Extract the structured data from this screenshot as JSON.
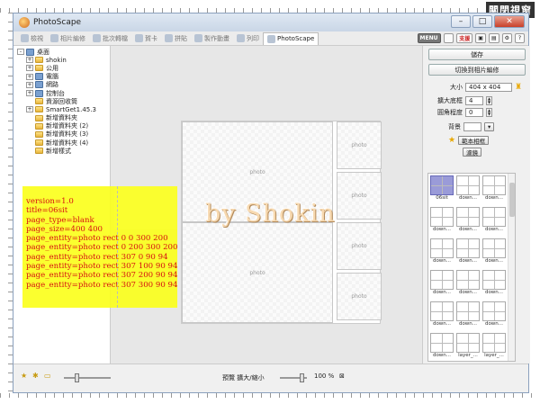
{
  "corner_label": "關閉視窗",
  "window": {
    "title": "PhotoScape"
  },
  "tabs": [
    {
      "label": "檢視",
      "active": false
    },
    {
      "label": "相片編修",
      "active": false
    },
    {
      "label": "批次轉檔",
      "active": false
    },
    {
      "label": "賀卡",
      "active": false
    },
    {
      "label": "拼貼",
      "active": false
    },
    {
      "label": "製作動畫",
      "active": false
    },
    {
      "label": "列印",
      "active": false
    },
    {
      "label": "PhotoScape",
      "active": true
    }
  ],
  "toolbar": {
    "menu_label": "MENU",
    "support_label": "支援"
  },
  "tree": [
    {
      "label": "桌面",
      "level": 0,
      "expander": "-",
      "icon": "desktop"
    },
    {
      "label": "shokin",
      "level": 1,
      "expander": "+",
      "icon": "folder"
    },
    {
      "label": "公用",
      "level": 1,
      "expander": "+",
      "icon": "folder"
    },
    {
      "label": "電腦",
      "level": 1,
      "expander": "+",
      "icon": "computer"
    },
    {
      "label": "網路",
      "level": 1,
      "expander": "+",
      "icon": "network"
    },
    {
      "label": "控制台",
      "level": 1,
      "expander": "+",
      "icon": "control"
    },
    {
      "label": "資源回收筒",
      "level": 1,
      "expander": "",
      "icon": "recycle"
    },
    {
      "label": "SmartGet1.45.3",
      "level": 1,
      "expander": "+",
      "icon": "folder"
    },
    {
      "label": "新增資料夾",
      "level": 1,
      "expander": "",
      "icon": "folder"
    },
    {
      "label": "新增資料夾 (2)",
      "level": 1,
      "expander": "",
      "icon": "folder"
    },
    {
      "label": "新增資料夾 (3)",
      "level": 1,
      "expander": "",
      "icon": "folder"
    },
    {
      "label": "新增資料夾 (4)",
      "level": 1,
      "expander": "",
      "icon": "folder"
    },
    {
      "label": "新增樣式",
      "level": 1,
      "expander": "",
      "icon": "folder"
    }
  ],
  "canvas": {
    "slot_label": "photo",
    "slots": [
      {
        "label": "photo"
      },
      {
        "label": "photo"
      },
      {
        "label": "photo"
      },
      {
        "label": "photo"
      },
      {
        "label": "photo"
      },
      {
        "label": "photo"
      }
    ]
  },
  "right_panel": {
    "save_label": "儲存",
    "switch_label": "切換到相片編修",
    "size_label": "大小",
    "size_value": "404 x 404",
    "margin_label": "擴大底框",
    "margin_value": "4",
    "roundness_label": "圓角程度",
    "roundness_value": "0",
    "background_label": "背景",
    "frame_label": "範本相框",
    "filter_label": "濾鏡"
  },
  "thumbnails": [
    "06sit",
    "down...",
    "down...",
    "down...",
    "down...",
    "down...",
    "down...",
    "down...",
    "down...",
    "down...",
    "down...",
    "down...",
    "down...",
    "down...",
    "down...",
    "down...",
    "layer_...",
    "layer_...",
    "",
    "",
    ""
  ],
  "bottom": {
    "preview_label": "預覽 擴大/縮小",
    "zoom_value": "100 %"
  },
  "overlay_note": {
    "lines": [
      "version=1.0",
      "title=06sit",
      "page_type=blank",
      "page_size=400 400",
      "page_entity=photo rect 0 0 300 200",
      "page_entity=photo rect 0 200 300 200",
      "page_entity=photo rect 307 0 90 94",
      "page_entity=photo rect 307 100 90 94",
      "page_entity=photo rect 307 200 90 94",
      "page_entity=photo rect 307 300 90 94"
    ]
  },
  "watermark": "by Shokin",
  "colors": {
    "note_bg": "#fbff20",
    "note_text": "#d40000",
    "selected_thumb": "#9a9bd8"
  }
}
